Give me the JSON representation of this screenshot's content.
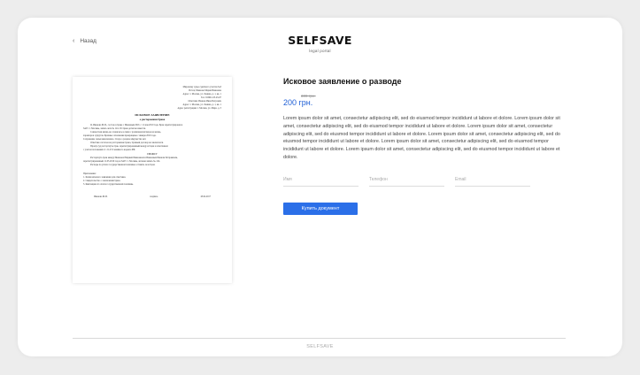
{
  "nav": {
    "back_label": "Назад"
  },
  "brand": {
    "title": "SELFSAVE",
    "subtitle": "legal portal"
  },
  "document_preview": {
    "header_lines": [
      "Мировому судье судебного участка №3",
      "Истец: Иванова Мария Ивановна",
      "Адрес: г. Москва, ул. Ленина, д. 1, кв. 1",
      "Тел. 8-999-123-45-67",
      "Ответчик: Иванов Иван Петрович",
      "Адрес: г. Москва, ул. Ленина, д. 1, кв. 1",
      "Адрес регистрации: г. Москва, ул. Мира, д. 5"
    ],
    "title": "ИСКОВОЕ ЗАЯВЛЕНИЕ",
    "subtitle": "о расторжении брака",
    "body_lines": [
      "Я, Иванова М.И., состою в браке с Ивановым И.П. с 11 мая 2010 года. Брак зарегистрирован в",
      "ЗАГС г. Москвы, запись акта № 124. От брака детей не имеется.",
      "Совместная жизнь не сложилась в связи с различием взглядов на жизнь,",
      "характеров супругов. Брачные отношения прекращены с января 2019 года.",
      "Сохранение семьи невозможно. Спора о разделе имущества нет.",
      "Ответчик согласен на расторжение брака, брачный договор не заключался.",
      "Прошу суд расторгнуть брак, зарегистрированный между истцом и ответчиком",
      "с учетом положений ст. 21-23 Семейного кодекса РФ."
    ],
    "prayer": "ПРОШУ",
    "prayer_lines": [
      "Расторгнуть брак между Ивановой Марией Ивановной и Ивановым Иваном Петровичем,",
      "зарегистрированный 11.05.2010 года в ЗАГС г. Москвы, актовая запись № 124.",
      "Расходы по уплате государственной пошлины оставить за истцом."
    ],
    "attachments_title": "Приложение:",
    "attachments": [
      "1. Копия искового заявления для ответчика.",
      "2. Свидетельство о заключении брака.",
      "3. Квитанция об оплате государственной пошлины."
    ],
    "sign_name": "Иванова М.И.",
    "sign_label": "подпись",
    "sign_date": "18.04.2017"
  },
  "product": {
    "title": "Исковое заявление о разводе",
    "old_price": "300 грн.",
    "price": "200 грн.",
    "description": "Lorem ipsum dolor sit amet, consectetur adipiscing elit, sed do eiusmod tempor incididunt ut labore et dolore. Lorem ipsum dolor sit amet, consectetur adipiscing elit, sed do eiusmod tempor incididunt ut labore et dolore. Lorem ipsum dolor sit amet, consectetur adipiscing elit, sed do eiusmod tempor incididunt ut labore et dolore. Lorem ipsum dolor sit amet, consectetur adipiscing elit, sed do eiusmod tempor incididunt ut labore et dolore. Lorem ipsum dolor sit amet, consectetur adipiscing elit, sed do eiusmod tempor incididunt ut labore et dolore. Lorem ipsum dolor sit amet, consectetur adipiscing elit, sed do eiusmod tempor incididunt ut labore et dolore."
  },
  "form": {
    "name_placeholder": "Имя",
    "phone_placeholder": "Телефон",
    "email_placeholder": "Email",
    "buy_label": "Купить документ"
  },
  "footer": {
    "text": "SELFSAVE"
  },
  "colors": {
    "accent": "#2b6fe8",
    "price": "#1f5fd6",
    "background": "#ededed"
  }
}
